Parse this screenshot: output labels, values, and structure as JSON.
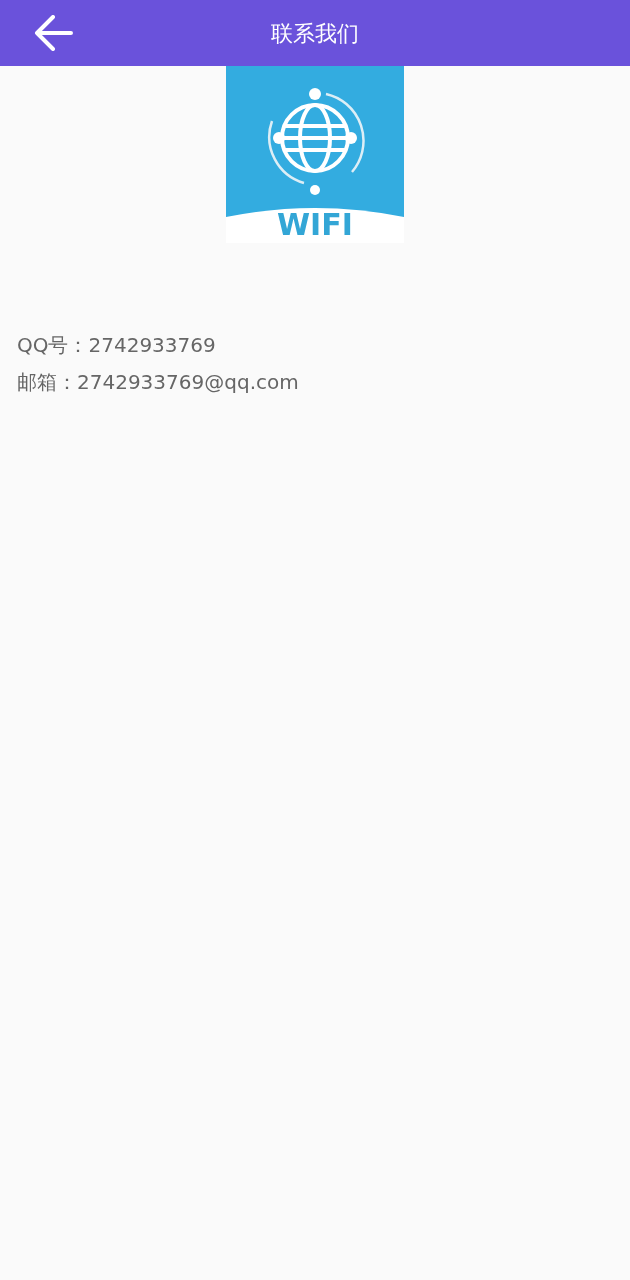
{
  "header": {
    "title": "联系我们"
  },
  "logo": {
    "text": "WIFI"
  },
  "contact_lines": [
    "QQ号：2742933769",
    "邮箱：2742933769@qq.com"
  ]
}
